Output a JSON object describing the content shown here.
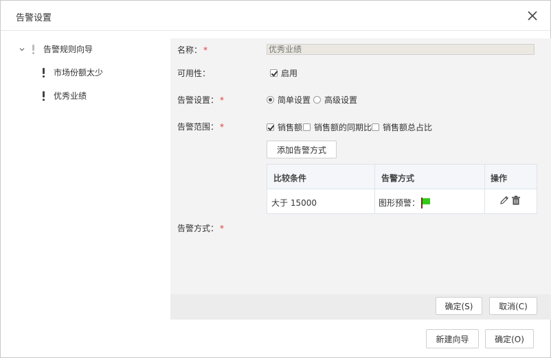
{
  "dialog": {
    "title": "告警设置"
  },
  "tree": {
    "root_label": "告警规则向导",
    "items": [
      {
        "label": "市场份额太少"
      },
      {
        "label": "优秀业绩"
      }
    ]
  },
  "form": {
    "name_label": "名称：",
    "name_value": "优秀业绩",
    "availability_label": "可用性：",
    "enable_label": "启用",
    "alert_setting_label": "告警设置：",
    "simple_label": "简单设置",
    "advanced_label": "高级设置",
    "alert_scope_label": "告警范围：",
    "scope_options": [
      {
        "label": "销售额",
        "checked": true
      },
      {
        "label": "销售额的同期比",
        "checked": false
      },
      {
        "label": "销售额总占比",
        "checked": false
      }
    ],
    "add_alert_button": "添加告警方式",
    "table": {
      "headers": [
        "比较条件",
        "告警方式",
        "操作"
      ],
      "rows": [
        {
          "condition": "大于 15000",
          "method": "图形预警："
        }
      ]
    },
    "alert_method_label": "告警方式：",
    "required_mark": "*"
  },
  "panel_buttons": {
    "ok": "确定(S)",
    "cancel": "取消(C)"
  },
  "footer_buttons": {
    "new_wizard": "新建向导",
    "ok": "确定(O)"
  },
  "colors": {
    "required": "#e0393e",
    "flag_green": "#33cc1a",
    "flag_pole": "#7a2b19"
  }
}
